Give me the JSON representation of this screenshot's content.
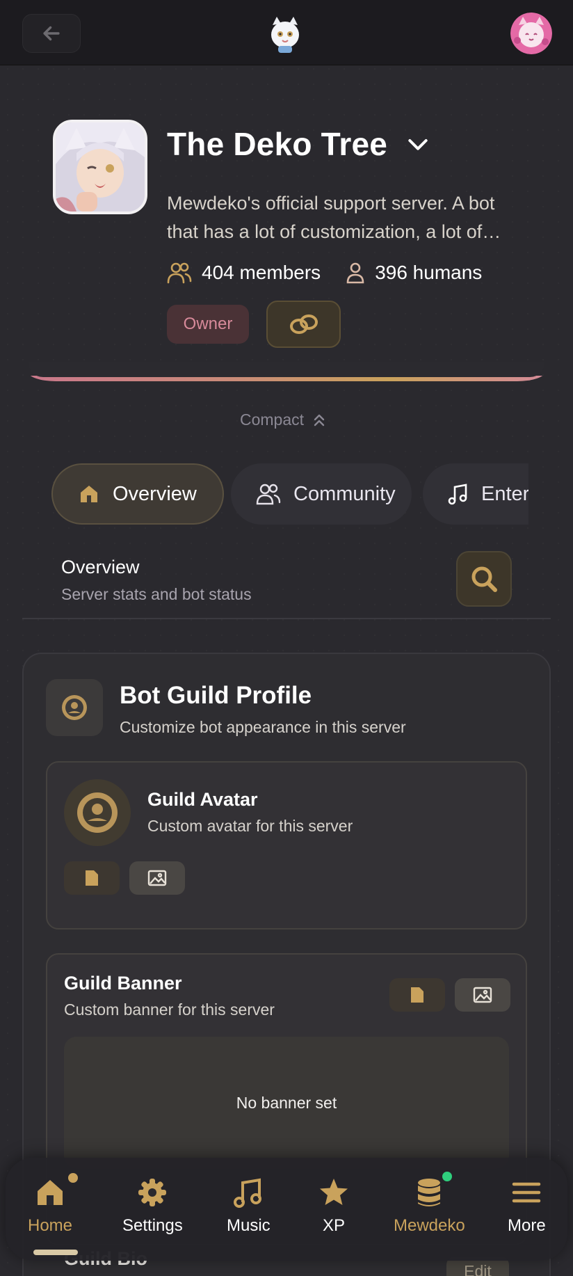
{
  "colors": {
    "accent": "#c9a25c",
    "owner_badge": "#d78a9a",
    "online_dot": "#2fcf7d"
  },
  "topbar": {
    "back_icon": "arrow-left-icon"
  },
  "server": {
    "name": "The Deko Tree",
    "description": "Mewdeko's official support server. A bot that has a lot of customization, a lot of…",
    "members": "404 members",
    "humans": "396 humans",
    "owner_badge": "Owner"
  },
  "compact_label": "Compact",
  "tabs": [
    {
      "label": "Overview",
      "icon": "home-icon",
      "active": true
    },
    {
      "label": "Community",
      "icon": "users-icon",
      "active": false
    },
    {
      "label": "Enter",
      "icon": "music-icon",
      "active": false
    }
  ],
  "section": {
    "title": "Overview",
    "subtitle": "Server stats and bot status"
  },
  "bot_profile": {
    "title": "Bot Guild Profile",
    "subtitle": "Customize bot appearance in this server",
    "avatar": {
      "title": "Guild Avatar",
      "subtitle": "Custom avatar for this server"
    },
    "banner": {
      "title": "Guild Banner",
      "subtitle": "Custom banner for this server",
      "empty_text": "No banner set"
    },
    "bio": {
      "title": "Guild Bio",
      "edit_label": "Edit"
    }
  },
  "bottom_nav": [
    {
      "label": "Home",
      "icon": "home-icon",
      "active": true
    },
    {
      "label": "Settings",
      "icon": "gear-icon",
      "active": false
    },
    {
      "label": "Music",
      "icon": "music-icon",
      "active": false
    },
    {
      "label": "XP",
      "icon": "star-icon",
      "active": false
    },
    {
      "label": "Mewdeko",
      "icon": "database-icon",
      "active": false
    },
    {
      "label": "More",
      "icon": "menu-icon",
      "active": false
    }
  ]
}
